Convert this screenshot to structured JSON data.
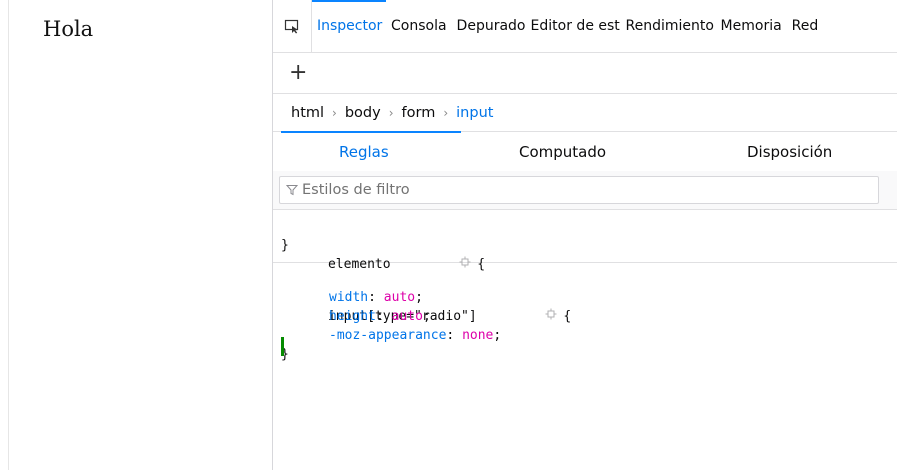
{
  "page": {
    "text": "Hola"
  },
  "devtools": {
    "tabs": [
      {
        "label": "Inspector",
        "selected": true
      },
      {
        "label": "Consola",
        "selected": false
      },
      {
        "label": "Depurador",
        "selected": false
      },
      {
        "label": "Editor de estilos",
        "selected": false
      },
      {
        "label": "Rendimiento",
        "selected": false
      },
      {
        "label": "Memoria",
        "selected": false
      },
      {
        "label": "Red",
        "selected": false
      }
    ],
    "toolbar": {
      "add_node": "+"
    },
    "breadcrumb": [
      "html",
      "body",
      "form",
      "input"
    ],
    "sidepanel_tabs": [
      "Reglas",
      "Computado",
      "Disposición"
    ],
    "filter": {
      "placeholder": "Estilos de filtro"
    },
    "rules": {
      "element": {
        "selector": "elemento",
        "open": "{",
        "close": "}"
      },
      "input": {
        "selector": "input[type=\"radio\"]",
        "open": "{",
        "close": "}",
        "declarations": [
          {
            "property": "width",
            "value": "auto"
          },
          {
            "property": "height",
            "value": "auto"
          },
          {
            "property": "-moz-appearance",
            "value": "none",
            "changed": true
          }
        ]
      }
    },
    "colors": {
      "accent": "#0a84ff",
      "property": "#0074e8",
      "value": "#dd00a9",
      "changed": "#058b00"
    }
  }
}
